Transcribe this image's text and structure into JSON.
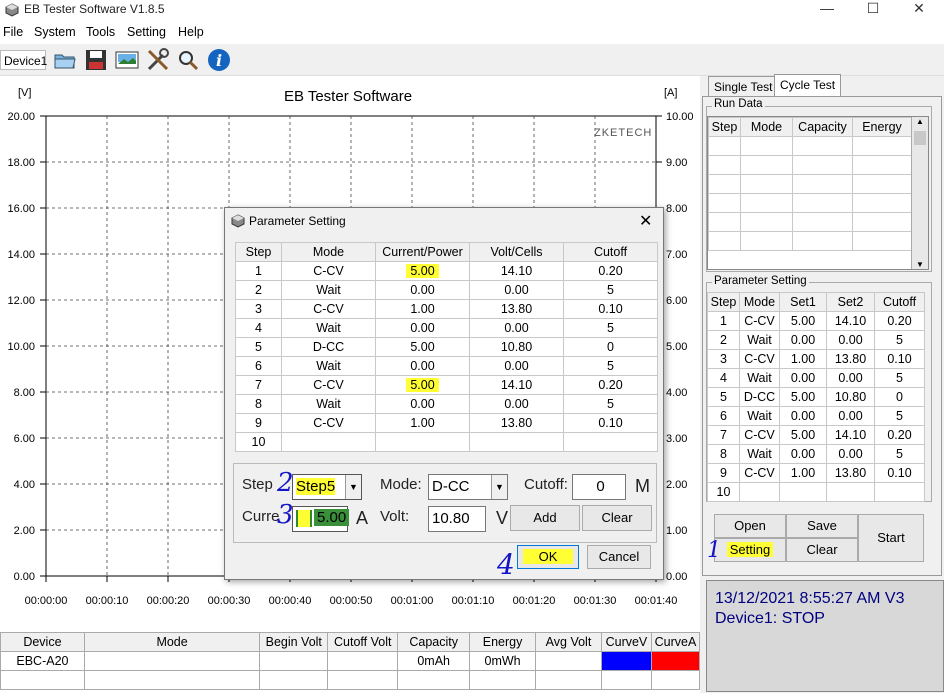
{
  "window": {
    "title": "EB Tester Software V1.8.5",
    "minimize": "—",
    "maximize": "☐",
    "close": "✕"
  },
  "menu": [
    "File",
    "System",
    "Tools",
    "Setting",
    "Help"
  ],
  "toolbar": {
    "device": "Device1"
  },
  "chart": {
    "title": "EB Tester Software",
    "watermark": "ZKETECH",
    "left_unit": "[V]",
    "right_unit": "[A]"
  },
  "chart_data": {
    "type": "line",
    "title": "EB Tester Software",
    "ylabel": "[V]",
    "y2label": "[A]",
    "ylim": [
      0,
      20
    ],
    "y2lim": [
      0,
      10
    ],
    "y_ticks": [
      "20.00",
      "18.00",
      "16.00",
      "14.00",
      "12.00",
      "10.00",
      "8.00",
      "6.00",
      "4.00",
      "2.00",
      "0.00"
    ],
    "y2_ticks": [
      "10.00",
      "9.00",
      "8.00",
      "7.00",
      "6.00",
      "5.00",
      "4.00",
      "3.00",
      "2.00",
      "1.00",
      "0.00"
    ],
    "x_ticks": [
      "00:00:00",
      "00:00:10",
      "00:00:20",
      "00:00:30",
      "00:00:40",
      "00:00:50",
      "00:01:00",
      "00:01:10",
      "00:01:20",
      "00:01:30",
      "00:01:40"
    ],
    "series": [],
    "grid": true
  },
  "device_table": {
    "headers": [
      "Device",
      "Mode",
      "Begin Volt",
      "Cutoff Volt",
      "Capacity",
      "Energy",
      "Avg Volt",
      "CurveV",
      "CurveA"
    ],
    "row": [
      "EBC-A20",
      "",
      "",
      "",
      "0mAh",
      "0mWh",
      "",
      "",
      ""
    ],
    "curve_v_color": "#0000ff",
    "curve_a_color": "#ff0000"
  },
  "right": {
    "tabs": [
      "Single Test",
      "Cycle Test"
    ],
    "run_data": {
      "label": "Run Data",
      "headers": [
        "Step",
        "Mode",
        "Capacity",
        "Energy"
      ]
    },
    "param": {
      "label": "Parameter Setting",
      "headers": [
        "Step",
        "Mode",
        "Set1",
        "Set2",
        "Cutoff"
      ],
      "rows": [
        [
          "1",
          "C-CV",
          "5.00",
          "14.10",
          "0.20"
        ],
        [
          "2",
          "Wait",
          "0.00",
          "0.00",
          "5"
        ],
        [
          "3",
          "C-CV",
          "1.00",
          "13.80",
          "0.10"
        ],
        [
          "4",
          "Wait",
          "0.00",
          "0.00",
          "5"
        ],
        [
          "5",
          "D-CC",
          "5.00",
          "10.80",
          "0"
        ],
        [
          "6",
          "Wait",
          "0.00",
          "0.00",
          "5"
        ],
        [
          "7",
          "C-CV",
          "5.00",
          "14.10",
          "0.20"
        ],
        [
          "8",
          "Wait",
          "0.00",
          "0.00",
          "5"
        ],
        [
          "9",
          "C-CV",
          "1.00",
          "13.80",
          "0.10"
        ],
        [
          "10",
          "",
          "",
          "",
          ""
        ]
      ]
    },
    "buttons": {
      "open": "Open",
      "save": "Save",
      "setting": "Setting",
      "clear": "Clear",
      "start": "Start"
    },
    "status": {
      "line1": "13/12/2021 8:55:27 AM  V3",
      "line2": "Device1: STOP"
    }
  },
  "dialog": {
    "title": "Parameter Setting",
    "close": "✕",
    "headers": [
      "Step",
      "Mode",
      "Current/Power",
      "Volt/Cells",
      "Cutoff"
    ],
    "rows": [
      [
        "1",
        "C-CV",
        "5.00",
        "14.10",
        "0.20"
      ],
      [
        "2",
        "Wait",
        "0.00",
        "0.00",
        "5"
      ],
      [
        "3",
        "C-CV",
        "1.00",
        "13.80",
        "0.10"
      ],
      [
        "4",
        "Wait",
        "0.00",
        "0.00",
        "5"
      ],
      [
        "5",
        "D-CC",
        "5.00",
        "10.80",
        "0"
      ],
      [
        "6",
        "Wait",
        "0.00",
        "0.00",
        "5"
      ],
      [
        "7",
        "C-CV",
        "5.00",
        "14.10",
        "0.20"
      ],
      [
        "8",
        "Wait",
        "0.00",
        "0.00",
        "5"
      ],
      [
        "9",
        "C-CV",
        "1.00",
        "13.80",
        "0.10"
      ],
      [
        "10",
        "",
        "",
        "",
        ""
      ]
    ],
    "step_label": "Step",
    "step_value": "Step5",
    "mode_label": "Mode:",
    "mode_value": "D-CC",
    "cutoff_label": "Cutoff:",
    "cutoff_value": "0",
    "cutoff_unit": "M",
    "curr_label": "Curre",
    "curr_value": "5.00",
    "curr_unit": "A",
    "volt_label": "Volt:",
    "volt_value": "10.80",
    "volt_unit": "V",
    "add": "Add",
    "clear": "Clear",
    "ok": "OK",
    "cancel": "Cancel",
    "highlight_color": "#ffff33"
  },
  "annotations": [
    "1",
    "2",
    "3",
    "4"
  ]
}
